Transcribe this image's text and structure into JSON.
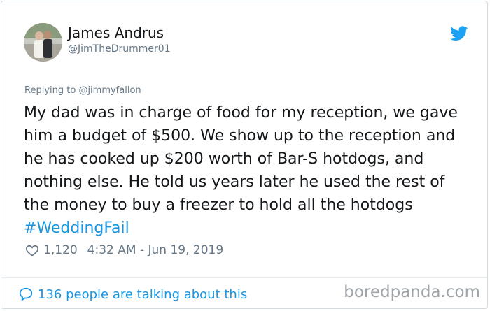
{
  "author": {
    "display_name": "James Andrus",
    "handle": "@JimTheDrummer01"
  },
  "reply": {
    "prefix": "Replying to",
    "mention": "@jimmyfallon"
  },
  "tweet": {
    "body": "My dad was in charge of food for my reception, we gave him a budget of $500. We show up to the reception and he has cooked up $200 worth of Bar-S hotdogs, and nothing else. He told us years later he used the rest of the money to buy a freezer to hold all the hotdogs",
    "hashtag": "#WeddingFail"
  },
  "meta": {
    "like_count": "1,120",
    "timestamp": "4:32 AM - Jun 19, 2019"
  },
  "footer": {
    "talking_label": "136 people are talking about this"
  },
  "watermark": "boredpanda.com",
  "icons": {
    "bird": "twitter-bird-icon",
    "heart": "heart-icon",
    "bubble": "speech-bubble-icon"
  },
  "colors": {
    "accent": "#1b95e0",
    "muted": "#657786",
    "text": "#14171a"
  }
}
